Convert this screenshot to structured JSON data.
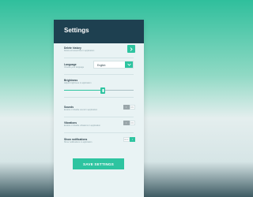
{
  "header": {
    "title": "Settings"
  },
  "settings": {
    "delete_history": {
      "label": "Delete history",
      "description": "Delete all saved files in application"
    },
    "language": {
      "label": "Language",
      "description": "Choose your language",
      "value": "English"
    },
    "brightness": {
      "label": "Brightness",
      "description": "Adjust brightness in application",
      "level": 0.56
    },
    "sounds": {
      "label": "Sounds",
      "description": "Enable or disable sound in application",
      "toggle_left": "I",
      "toggle_right": "ON",
      "state": "off"
    },
    "vibrations": {
      "label": "Vibrations",
      "description": "Enable or disable vibrations in application",
      "toggle_left": "I",
      "toggle_right": "ON",
      "state": "off"
    },
    "show_notifications": {
      "label": "Show notifications",
      "description": "Show notifications in application",
      "toggle_left": "OFF",
      "toggle_right": "I",
      "state": "on"
    }
  },
  "save_button": {
    "label": "SAVE SETTINGS"
  },
  "colors": {
    "accent": "#2ec4a0",
    "header": "#1e4050",
    "panel": "#e9f3f4",
    "toggle_off": "#9aa6aa"
  },
  "icons": {
    "arrow": "chevron-right-icon",
    "dropdown": "chevron-down-icon",
    "slider": "grip-icon"
  }
}
